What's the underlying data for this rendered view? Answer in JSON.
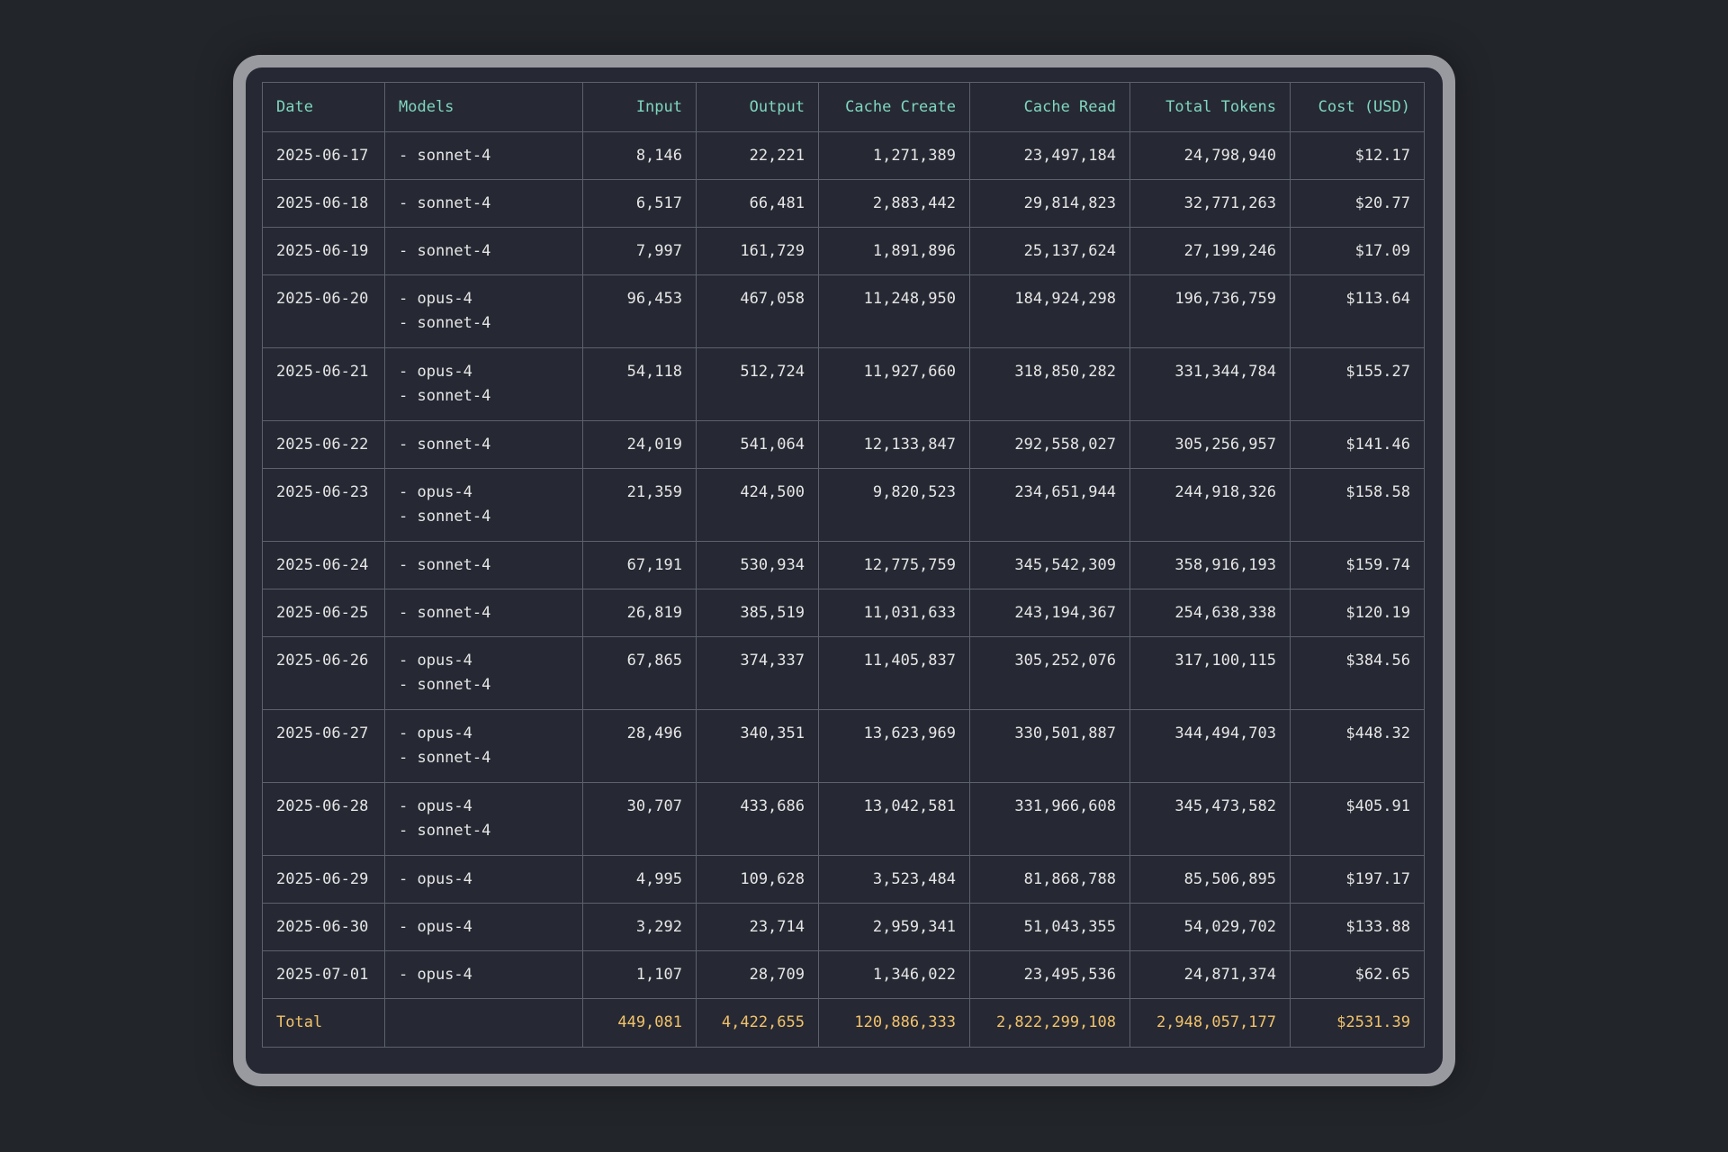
{
  "table": {
    "headers": {
      "date": "Date",
      "models": "Models",
      "input": "Input",
      "output": "Output",
      "cache_create": "Cache Create",
      "cache_read": "Cache Read",
      "total_tokens": "Total Tokens",
      "cost": "Cost (USD)"
    },
    "rows": [
      {
        "date": "2025-06-17",
        "models": [
          "- sonnet-4"
        ],
        "input": "8,146",
        "output": "22,221",
        "cache_create": "1,271,389",
        "cache_read": "23,497,184",
        "total_tokens": "24,798,940",
        "cost": "$12.17"
      },
      {
        "date": "2025-06-18",
        "models": [
          "- sonnet-4"
        ],
        "input": "6,517",
        "output": "66,481",
        "cache_create": "2,883,442",
        "cache_read": "29,814,823",
        "total_tokens": "32,771,263",
        "cost": "$20.77"
      },
      {
        "date": "2025-06-19",
        "models": [
          "- sonnet-4"
        ],
        "input": "7,997",
        "output": "161,729",
        "cache_create": "1,891,896",
        "cache_read": "25,137,624",
        "total_tokens": "27,199,246",
        "cost": "$17.09"
      },
      {
        "date": "2025-06-20",
        "models": [
          "- opus-4",
          "- sonnet-4"
        ],
        "input": "96,453",
        "output": "467,058",
        "cache_create": "11,248,950",
        "cache_read": "184,924,298",
        "total_tokens": "196,736,759",
        "cost": "$113.64"
      },
      {
        "date": "2025-06-21",
        "models": [
          "- opus-4",
          "- sonnet-4"
        ],
        "input": "54,118",
        "output": "512,724",
        "cache_create": "11,927,660",
        "cache_read": "318,850,282",
        "total_tokens": "331,344,784",
        "cost": "$155.27"
      },
      {
        "date": "2025-06-22",
        "models": [
          "- sonnet-4"
        ],
        "input": "24,019",
        "output": "541,064",
        "cache_create": "12,133,847",
        "cache_read": "292,558,027",
        "total_tokens": "305,256,957",
        "cost": "$141.46"
      },
      {
        "date": "2025-06-23",
        "models": [
          "- opus-4",
          "- sonnet-4"
        ],
        "input": "21,359",
        "output": "424,500",
        "cache_create": "9,820,523",
        "cache_read": "234,651,944",
        "total_tokens": "244,918,326",
        "cost": "$158.58"
      },
      {
        "date": "2025-06-24",
        "models": [
          "- sonnet-4"
        ],
        "input": "67,191",
        "output": "530,934",
        "cache_create": "12,775,759",
        "cache_read": "345,542,309",
        "total_tokens": "358,916,193",
        "cost": "$159.74"
      },
      {
        "date": "2025-06-25",
        "models": [
          "- sonnet-4"
        ],
        "input": "26,819",
        "output": "385,519",
        "cache_create": "11,031,633",
        "cache_read": "243,194,367",
        "total_tokens": "254,638,338",
        "cost": "$120.19"
      },
      {
        "date": "2025-06-26",
        "models": [
          "- opus-4",
          "- sonnet-4"
        ],
        "input": "67,865",
        "output": "374,337",
        "cache_create": "11,405,837",
        "cache_read": "305,252,076",
        "total_tokens": "317,100,115",
        "cost": "$384.56"
      },
      {
        "date": "2025-06-27",
        "models": [
          "- opus-4",
          "- sonnet-4"
        ],
        "input": "28,496",
        "output": "340,351",
        "cache_create": "13,623,969",
        "cache_read": "330,501,887",
        "total_tokens": "344,494,703",
        "cost": "$448.32"
      },
      {
        "date": "2025-06-28",
        "models": [
          "- opus-4",
          "- sonnet-4"
        ],
        "input": "30,707",
        "output": "433,686",
        "cache_create": "13,042,581",
        "cache_read": "331,966,608",
        "total_tokens": "345,473,582",
        "cost": "$405.91"
      },
      {
        "date": "2025-06-29",
        "models": [
          "- opus-4"
        ],
        "input": "4,995",
        "output": "109,628",
        "cache_create": "3,523,484",
        "cache_read": "81,868,788",
        "total_tokens": "85,506,895",
        "cost": "$197.17"
      },
      {
        "date": "2025-06-30",
        "models": [
          "- opus-4"
        ],
        "input": "3,292",
        "output": "23,714",
        "cache_create": "2,959,341",
        "cache_read": "51,043,355",
        "total_tokens": "54,029,702",
        "cost": "$133.88"
      },
      {
        "date": "2025-07-01",
        "models": [
          "- opus-4"
        ],
        "input": "1,107",
        "output": "28,709",
        "cache_create": "1,346,022",
        "cache_read": "23,495,536",
        "total_tokens": "24,871,374",
        "cost": "$62.65"
      }
    ],
    "total": {
      "label": "Total",
      "models": "",
      "input": "449,081",
      "output": "4,422,655",
      "cache_create": "120,886,333",
      "cache_read": "2,822,299,108",
      "total_tokens": "2,948,057,177",
      "cost": "$2531.39"
    }
  },
  "colors": {
    "background": "#22252a",
    "panel": "#262933",
    "frame": "#989aa0",
    "header_text": "#7fd6bf",
    "total_text": "#f2c26b",
    "body_text": "#e6e6e6",
    "grid": "#5c616c"
  }
}
